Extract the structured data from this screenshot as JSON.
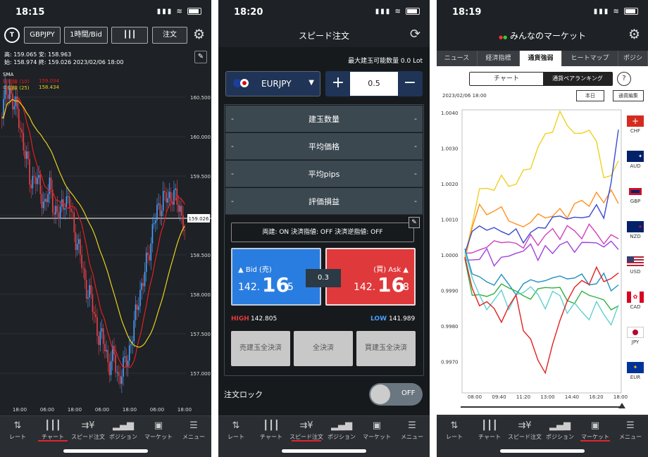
{
  "screen1": {
    "time": "18:15",
    "symbol": "GBPJPY",
    "timeframe": "1時間/Bid",
    "order_label": "注文",
    "ohlc_line1": "高: 159.065  安: 158.963",
    "ohlc_line2": "始: 158.974  終: 159.026  2023/02/06 18:00",
    "sma_title": "SMA",
    "sma_short_label": "短期線 (10)",
    "sma_short_value": "159.034",
    "sma_mid_label": "中期線 (25)",
    "sma_mid_value": "158.434",
    "current_price": "159.026",
    "y_ticks": [
      "160.500",
      "160.000",
      "159.500",
      "159.000",
      "158.500",
      "158.000",
      "157.500",
      "157.000"
    ],
    "x_ticks": [
      "18:00",
      "06:00",
      "18:00",
      "06:00",
      "18:00",
      "06:00",
      "18:00"
    ],
    "colors": {
      "up": "#4aa3ff",
      "down": "#e8414a",
      "sma_short": "#e02020",
      "sma_mid": "#e8d020"
    }
  },
  "screen2": {
    "time": "18:20",
    "title": "スピード注文",
    "max_qty": "最大建玉可能数量 0.0 Lot",
    "pair": "EURJPY",
    "qty": "0.5",
    "plus": "+",
    "minus": "−",
    "rows": [
      {
        "label": "建玉数量",
        "left": "-",
        "right": "-"
      },
      {
        "label": "平均価格",
        "left": "-",
        "right": "-"
      },
      {
        "label": "平均pips",
        "left": "-",
        "right": "-"
      },
      {
        "label": "評価損益",
        "left": "-",
        "right": "-"
      }
    ],
    "settings": "両建: ON   決済指値: OFF   決済逆指値: OFF",
    "bid_label": "▲ Bid (売)",
    "bid_prefix": "142.",
    "bid_big": "16",
    "bid_small": "5",
    "ask_label": "(買) Ask ▲",
    "ask_prefix": "142.",
    "ask_big": "16",
    "ask_small": "8",
    "spread": "0.3",
    "high_label": "HIGH",
    "high_value": "142.805",
    "low_label": "LOW",
    "low_value": "141.989",
    "btn_sell_close": "売建玉全決済",
    "btn_all_close": "全決済",
    "btn_buy_close": "買建玉全決済",
    "lock_label": "注文ロック",
    "lock_state": "OFF"
  },
  "screen3": {
    "time": "18:19",
    "title": "みんなのマーケット",
    "tabs": [
      "ニュース",
      "経済指標",
      "通貨強弱",
      "ヒートマップ",
      "ポジシ"
    ],
    "seg_chart": "チャート",
    "seg_ranking": "通貨ペアランキング",
    "help": "?",
    "date": "2023/02/06 18:00",
    "today_btn": "本日",
    "edit_btn": "通貨編集",
    "y_ticks": [
      "1.0040",
      "1.0030",
      "1.0020",
      "1.0010",
      "1.0000",
      "0.9990",
      "0.9980",
      "0.9970"
    ],
    "x_ticks": [
      "08:00",
      "09:40",
      "11:20",
      "13:00",
      "14:40",
      "16:20",
      "18:00"
    ],
    "currencies": [
      "CHF",
      "AUD",
      "GBP",
      "NZD",
      "USD",
      "CAD",
      "JPY",
      "EUR"
    ]
  },
  "tabbar": [
    {
      "label": "レート",
      "icon": "rate-icon"
    },
    {
      "label": "チャート",
      "icon": "chart-icon"
    },
    {
      "label": "スピード注文",
      "icon": "speed-order-icon"
    },
    {
      "label": "ポジション",
      "icon": "position-icon"
    },
    {
      "label": "マーケット",
      "icon": "market-icon"
    },
    {
      "label": "メニュー",
      "icon": "menu-icon"
    }
  ]
}
